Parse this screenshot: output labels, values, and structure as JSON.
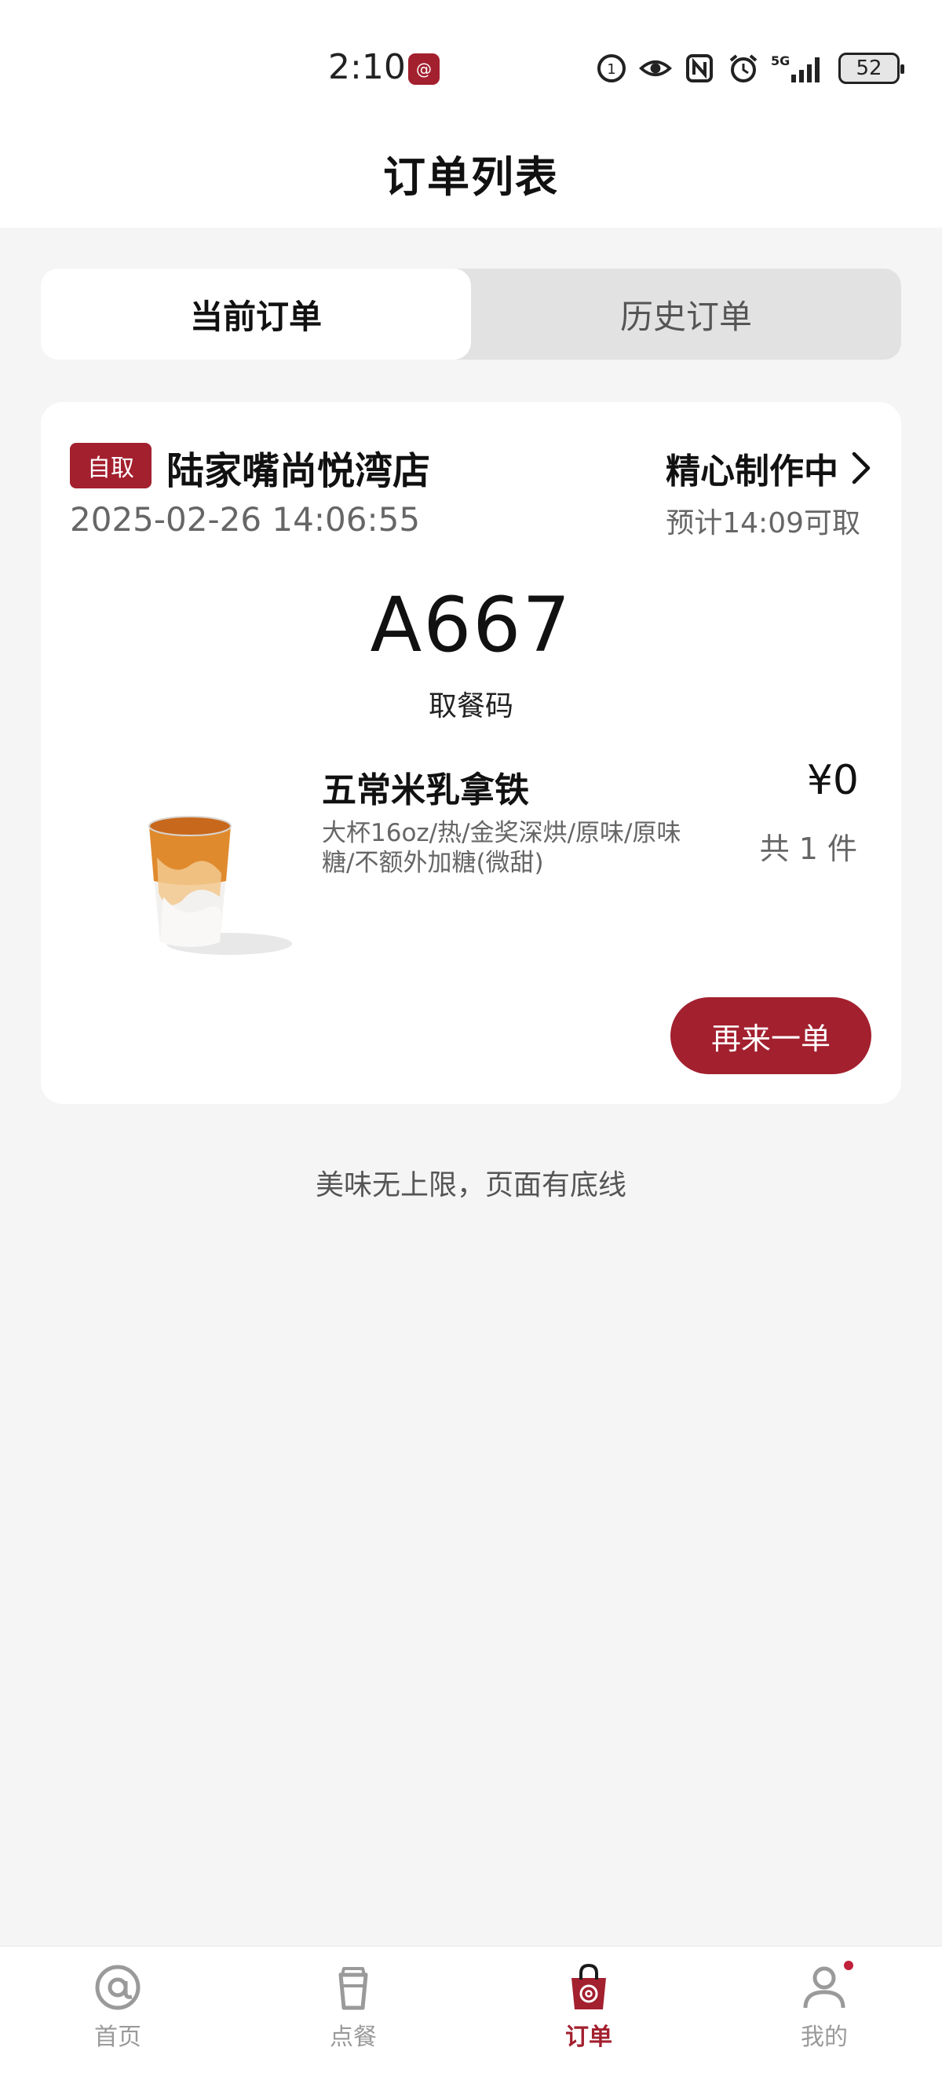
{
  "status_bar": {
    "time": "2:10",
    "app_badge": "@",
    "network": "5G",
    "battery": "52"
  },
  "header": {
    "title": "订单列表"
  },
  "segment": {
    "current": "当前订单",
    "history": "历史订单"
  },
  "order": {
    "tag": "自取",
    "store": "陆家嘴尚悦湾店",
    "datetime": "2025-02-26 14:06:55",
    "status": "精心制作中",
    "eta": "预计14:09可取",
    "pickup_code": "A667",
    "pickup_label": "取餐码",
    "item": {
      "name": "五常米乳拿铁",
      "spec": "大杯16oz/热/金奖深烘/原味/原味糖/不额外加糖(微甜)",
      "price": "¥0",
      "quantity": "共 1 件"
    },
    "reorder_label": "再来一单"
  },
  "footer_note": "美味无上限，页面有底线",
  "tabbar": {
    "items": [
      {
        "label": "首页",
        "icon": "at-icon"
      },
      {
        "label": "点餐",
        "icon": "cup-icon"
      },
      {
        "label": "订单",
        "icon": "bag-icon",
        "active": true
      },
      {
        "label": "我的",
        "icon": "person-icon"
      }
    ]
  },
  "colors": {
    "accent": "#a3202f",
    "background": "#f5f5f5"
  }
}
